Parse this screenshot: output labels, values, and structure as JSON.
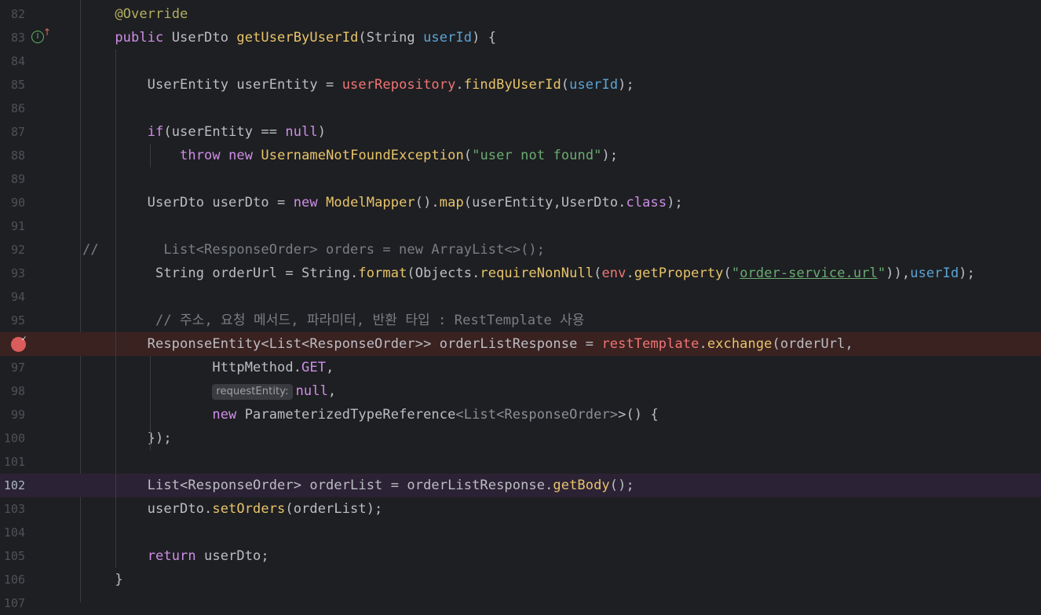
{
  "editor": {
    "lines": [
      {
        "n": "82",
        "code": [
          "    ",
          [
            "an",
            "@Override"
          ]
        ]
      },
      {
        "n": "83",
        "code": [
          "    ",
          [
            "k",
            "public"
          ],
          " UserDto ",
          [
            "m",
            "getUserByUserId"
          ],
          "(String ",
          [
            "pr",
            "userId"
          ],
          ") {"
        ],
        "impl": true
      },
      {
        "n": "84",
        "code": []
      },
      {
        "n": "85",
        "code": [
          "        UserEntity userEntity = ",
          [
            "f",
            "userRepository"
          ],
          ".",
          [
            "m",
            "findByUserId"
          ],
          "(",
          [
            "pr",
            "userId"
          ],
          ");"
        ]
      },
      {
        "n": "86",
        "code": []
      },
      {
        "n": "87",
        "code": [
          "        ",
          [
            "k",
            "if"
          ],
          "(userEntity == ",
          [
            "k",
            "null"
          ],
          ")"
        ]
      },
      {
        "n": "88",
        "code": [
          "            ",
          [
            "k",
            "throw"
          ],
          " ",
          [
            "k",
            "new"
          ],
          " ",
          [
            "m",
            "UsernameNotFoundException"
          ],
          "(",
          [
            "s",
            "\"user not found\""
          ],
          ");"
        ]
      },
      {
        "n": "89",
        "code": []
      },
      {
        "n": "90",
        "code": [
          "        UserDto userDto = ",
          [
            "k",
            "new"
          ],
          " ",
          [
            "m",
            "ModelMapper"
          ],
          "().",
          [
            "m",
            "map"
          ],
          "(userEntity,UserDto.",
          [
            "k",
            "class"
          ],
          ");"
        ]
      },
      {
        "n": "91",
        "code": []
      },
      {
        "n": "92",
        "code": [
          [
            "cm",
            "//        List<ResponseOrder> orders = new ArrayList<>();"
          ]
        ]
      },
      {
        "n": "93",
        "code": [
          "         String orderUrl = String.",
          [
            "m",
            "format"
          ],
          "(Objects.",
          [
            "m",
            "requireNonNull"
          ],
          "(",
          [
            "f",
            "env"
          ],
          ".",
          [
            "m",
            "getProperty"
          ],
          "(",
          [
            "s",
            "\""
          ],
          [
            "su",
            "order-service.url"
          ],
          [
            "s",
            "\""
          ],
          ")),",
          [
            "pr",
            "userId"
          ],
          ");"
        ]
      },
      {
        "n": "94",
        "code": []
      },
      {
        "n": "95",
        "code": [
          [
            "cm",
            "         // 주소, 요청 메서드, 파라미터, 반환 타입 : RestTemplate 사용"
          ]
        ]
      },
      {
        "n": "96",
        "code": [
          "        ResponseEntity<List<ResponseOrder>> orderListResponse = ",
          [
            "f",
            "restTemplate"
          ],
          ".",
          [
            "m",
            "exchange"
          ],
          "(orderUrl,"
        ],
        "breakpoint": true
      },
      {
        "n": "97",
        "code": [
          "                HttpMethod.",
          [
            "kr",
            "GET"
          ],
          ","
        ]
      },
      {
        "n": "98",
        "code": [
          "                ",
          [
            "inlay",
            "requestEntity:"
          ],
          [
            "k",
            "null"
          ],
          ","
        ]
      },
      {
        "n": "99",
        "code": [
          "                ",
          [
            "k",
            "new"
          ],
          " ParameterizedTypeReference",
          [
            "g",
            "<List<ResponseOrder>"
          ],
          ">() {"
        ]
      },
      {
        "n": "100",
        "code": [
          "        });"
        ]
      },
      {
        "n": "101",
        "code": []
      },
      {
        "n": "102",
        "code": [
          "        List<ResponseOrder> orderList = orderListResponse.",
          [
            "m",
            "getBody"
          ],
          "();"
        ],
        "current": true
      },
      {
        "n": "103",
        "code": [
          "        userDto.",
          [
            "m",
            "setOrders"
          ],
          "(orderList);"
        ]
      },
      {
        "n": "104",
        "code": []
      },
      {
        "n": "105",
        "code": [
          "        ",
          [
            "k",
            "return"
          ],
          " userDto;"
        ]
      },
      {
        "n": "106",
        "code": [
          "    }"
        ]
      },
      {
        "n": "107",
        "code": []
      }
    ],
    "colors": {
      "background": "#1e1f22",
      "breakpoint_line": "#3a2221",
      "current_line": "#2c2235",
      "keyword": "#cf8ee8",
      "method": "#e8c46a",
      "field": "#f07574",
      "parameter": "#5ca4d6",
      "string": "#6aab73",
      "comment": "#7a7e85",
      "annotation": "#b3ae60"
    },
    "icons": {
      "implements": "implements-icon",
      "breakpoint": "breakpoint-icon"
    }
  }
}
